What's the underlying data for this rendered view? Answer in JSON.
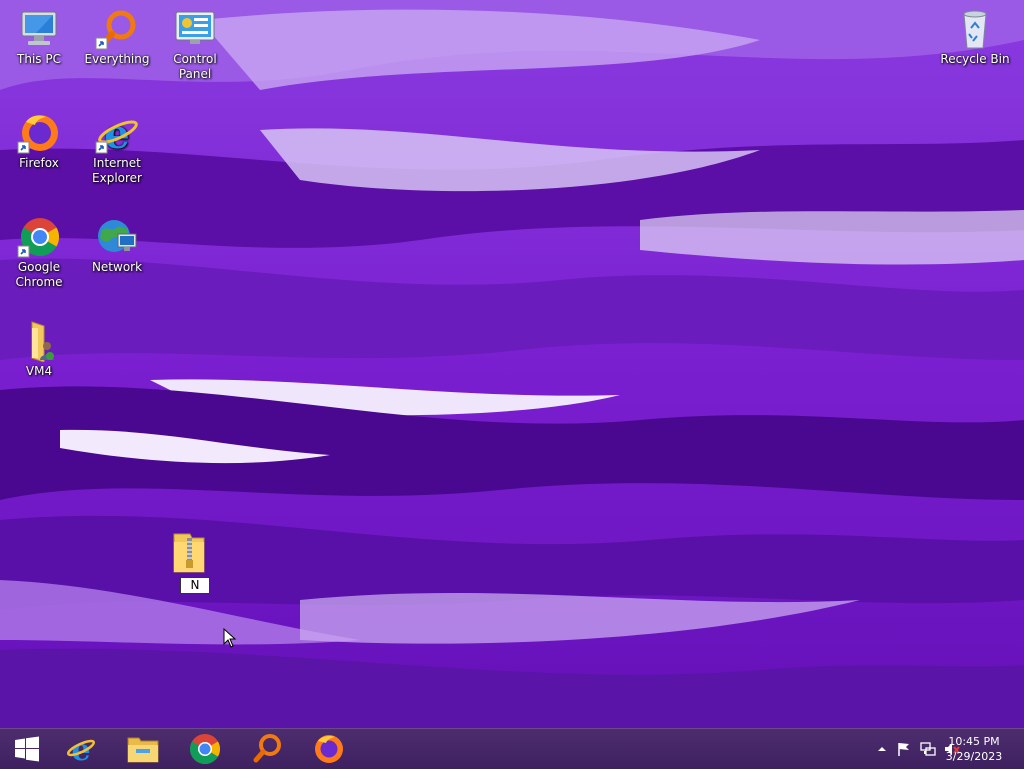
{
  "desktop": {
    "icons": [
      {
        "name": "this-pc",
        "label": "This PC"
      },
      {
        "name": "everything",
        "label": "Everything"
      },
      {
        "name": "control-panel",
        "label": "Control Panel"
      },
      {
        "name": "recycle-bin",
        "label": "Recycle Bin"
      },
      {
        "name": "firefox",
        "label": "Firefox"
      },
      {
        "name": "internet-explorer",
        "label": "Internet Explorer"
      },
      {
        "name": "google-chrome",
        "label": "Google Chrome"
      },
      {
        "name": "network",
        "label": "Network"
      },
      {
        "name": "vm4",
        "label": "VM4"
      }
    ],
    "rename": {
      "value": "N"
    }
  },
  "taskbar": {
    "pinned": [
      "start-icon",
      "internet-explorer-icon",
      "file-explorer-icon",
      "chrome-icon",
      "everything-icon",
      "firefox-icon"
    ],
    "clock": {
      "time": "10:45 PM",
      "date": "3/29/2023"
    },
    "tray": [
      "show-hidden-icons",
      "action-center-flag-icon",
      "network-icon",
      "volume-muted-icon"
    ]
  },
  "colors": {
    "wallpaper_base": "#7a1fd0",
    "taskbar": "#45286a"
  }
}
